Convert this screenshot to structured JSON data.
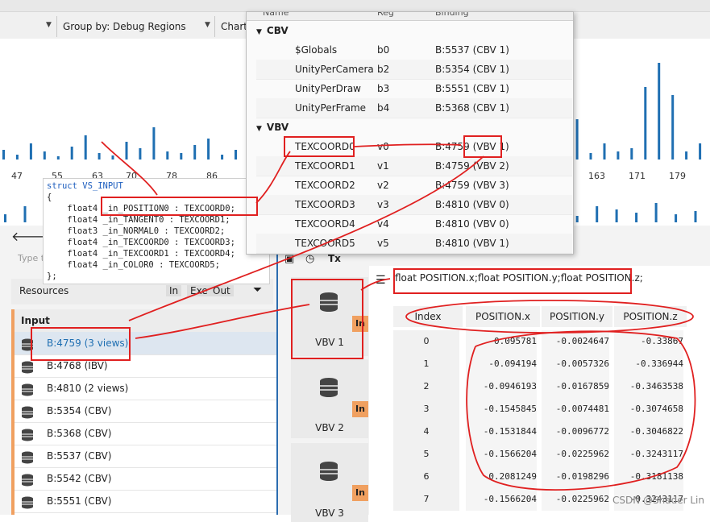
{
  "toolbar": {
    "group_by": "Group by: Debug Regions",
    "chart": "Chart"
  },
  "histogram": {
    "ticks": [
      "47",
      "55",
      "63",
      "70",
      "78",
      "86",
      "163",
      "171",
      "179"
    ],
    "bars_top": [
      12,
      6,
      20,
      10,
      4,
      16,
      30,
      8,
      5,
      22,
      14,
      40,
      10,
      8,
      18,
      26,
      6,
      12,
      60,
      90,
      20,
      8,
      14,
      30,
      10,
      50,
      96,
      120,
      40,
      10,
      22,
      8,
      14,
      60,
      30,
      18,
      10,
      44,
      8,
      70,
      24,
      12,
      50,
      8,
      20,
      10,
      14,
      90,
      120,
      80,
      10,
      20
    ],
    "bars_bottom": [
      10,
      20,
      8,
      14,
      30,
      6,
      12,
      24,
      8,
      18,
      12,
      10,
      26,
      8,
      16,
      20,
      12,
      10,
      14,
      30,
      22,
      8,
      12,
      24,
      10,
      18,
      14,
      26,
      10,
      8,
      20,
      16,
      12,
      24,
      10,
      14
    ]
  },
  "binding_panel": {
    "columns": [
      "Name",
      "Reg",
      "Binding"
    ],
    "groups": [
      {
        "name": "CBV",
        "rows": [
          {
            "name": "$Globals",
            "reg": "b0",
            "binding": "B:5537 (CBV 1)"
          },
          {
            "name": "UnityPerCamera",
            "reg": "b2",
            "binding": "B:5354 (CBV 1)"
          },
          {
            "name": "UnityPerDraw",
            "reg": "b3",
            "binding": "B:5551 (CBV 1)"
          },
          {
            "name": "UnityPerFrame",
            "reg": "b4",
            "binding": "B:5368 (CBV 1)"
          }
        ]
      },
      {
        "name": "VBV",
        "rows": [
          {
            "name": "TEXCOORD0",
            "reg": "v0",
            "binding": "B:4759 (VBV 1)"
          },
          {
            "name": "TEXCOORD1",
            "reg": "v1",
            "binding": "B:4759 (VBV 2)"
          },
          {
            "name": "TEXCOORD2",
            "reg": "v2",
            "binding": "B:4759 (VBV 3)"
          },
          {
            "name": "TEXCOORD3",
            "reg": "v3",
            "binding": "B:4810 (VBV 0)"
          },
          {
            "name": "TEXCOORD4",
            "reg": "v4",
            "binding": "B:4810 (VBV 0)"
          },
          {
            "name": "TEXCOORD5",
            "reg": "v5",
            "binding": "B:4810 (VBV 1)"
          }
        ]
      }
    ]
  },
  "code": {
    "lines": [
      "struct VS_INPUT",
      "{",
      "    float4 _in_POSITION0 : TEXCOORD0;",
      "    float4 _in_TANGENT0 : TEXCOORD1;",
      "    float3 _in_NORMAL0 : TEXCOORD2;",
      "    float4 _in_TEXCOORD0 : TEXCOORD3;",
      "    float4 _in_TEXCOORD1 : TEXCOORD4;",
      "    float4 _in_COLOR0 : TEXCOORD5;",
      "};"
    ]
  },
  "resources": {
    "search_placeholder": "Type t",
    "header": "Resources",
    "filters": [
      "In",
      "Exe",
      "Out"
    ],
    "section": "Input",
    "items": [
      "B:4759 (3 views)",
      "B:4768 (IBV)",
      "B:4810 (2 views)",
      "B:5354 (CBV)",
      "B:5368 (CBV)",
      "B:5537 (CBV)",
      "B:5542 (CBV)",
      "B:5551 (CBV)"
    ]
  },
  "views": {
    "tool_icons": [
      "image-icon",
      "history-icon",
      "Tx"
    ],
    "cards": [
      {
        "label": "VBV 1",
        "badge": "In"
      },
      {
        "label": "VBV 2",
        "badge": "In"
      },
      {
        "label": "VBV 3",
        "badge": "In"
      }
    ]
  },
  "buffer": {
    "format": "float POSITION.x;float POSITION.y;float POSITION.z;",
    "columns": [
      "Index",
      "POSITION.x",
      "POSITION.y",
      "POSITION.z"
    ],
    "rows": [
      [
        "0",
        "-0.095781",
        "-0.0024647",
        "-0.33867"
      ],
      [
        "1",
        "-0.094194",
        "-0.0057326",
        "-0.336944"
      ],
      [
        "2",
        "-0.0946193",
        "-0.0167859",
        "-0.3463538"
      ],
      [
        "3",
        "-0.1545845",
        "-0.0074481",
        "-0.3074658"
      ],
      [
        "4",
        "-0.1531844",
        "-0.0096772",
        "-0.3046822"
      ],
      [
        "5",
        "-0.1566204",
        "-0.0225962",
        "-0.3243117"
      ],
      [
        "6",
        "-0.2081249",
        "-0.0198296",
        "-0.3181138"
      ],
      [
        "7",
        "-0.1566204",
        "-0.0225962",
        "-0.3243117"
      ]
    ]
  },
  "watermark": "CSDN @Shader Lin",
  "colors": {
    "accent": "#1f6fb2",
    "badge": "#f0a060",
    "annotation": "#e02020"
  }
}
